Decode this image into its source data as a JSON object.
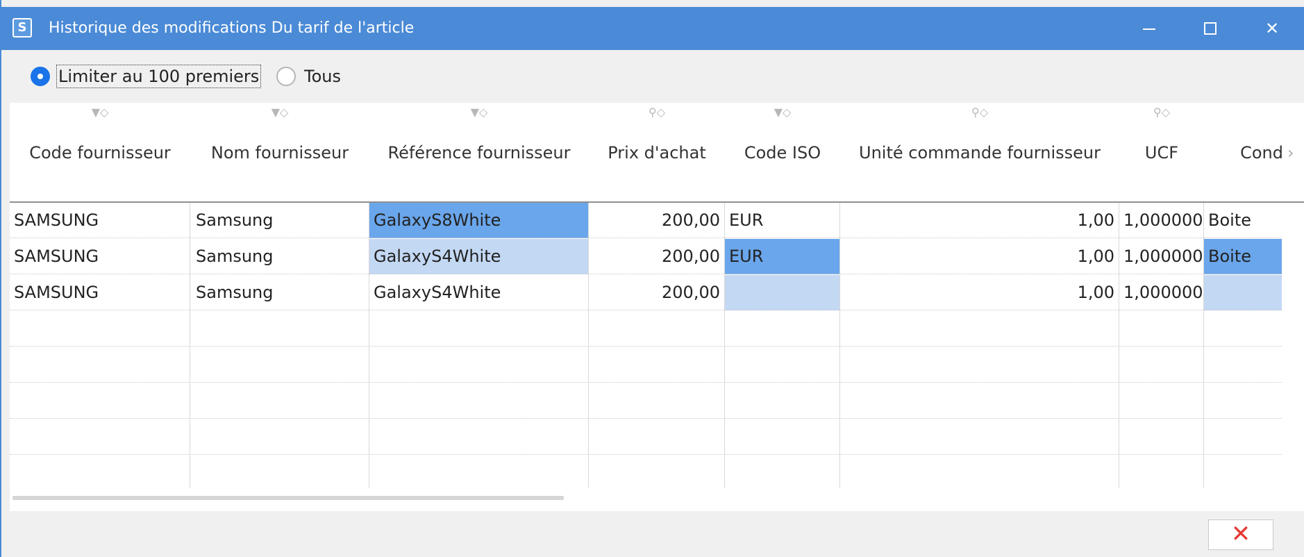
{
  "window": {
    "title": "Historique des modifications Du tarif de l'article",
    "app_icon": "S",
    "controls": {
      "minimize_icon": "minimize-icon",
      "maximize_icon": "maximize-icon",
      "close_glyph": "✕"
    }
  },
  "filter": {
    "options": [
      {
        "label": "Limiter au 100 premiers",
        "selected": true
      },
      {
        "label": "Tous",
        "selected": false
      }
    ]
  },
  "grid": {
    "columns": [
      {
        "label": "Code fournisseur",
        "icon": "▼◇"
      },
      {
        "label": "Nom fournisseur",
        "icon": "▼◇"
      },
      {
        "label": "Référence fournisseur",
        "icon": "▼◇"
      },
      {
        "label": "Prix d'achat",
        "icon": "⚲◇"
      },
      {
        "label": "Code ISO",
        "icon": "▼◇"
      },
      {
        "label": "Unité commande fournisseur",
        "icon": "⚲◇"
      },
      {
        "label": "UCF",
        "icon": "⚲◇"
      },
      {
        "label": "Cond",
        "icon": ""
      }
    ],
    "more_arrow": "›",
    "rows": [
      [
        "SAMSUNG",
        "Samsung",
        "GalaxyS8White",
        "200,00",
        "EUR",
        "1,00",
        "1,000000",
        "Boite"
      ],
      [
        "SAMSUNG",
        "Samsung",
        "GalaxyS4White",
        "200,00",
        "EUR",
        "1,00",
        "1,000000",
        "Boite"
      ],
      [
        "SAMSUNG",
        "Samsung",
        "GalaxyS4White",
        "200,00",
        "",
        "1,00",
        "1,000000",
        ""
      ]
    ]
  },
  "footer": {
    "close_glyph": "✕"
  },
  "colors": {
    "titlebar": "#4a8ad6",
    "selection": "#6aa6eb",
    "selection_light": "#c3d8f3",
    "close_red": "#e53935"
  }
}
